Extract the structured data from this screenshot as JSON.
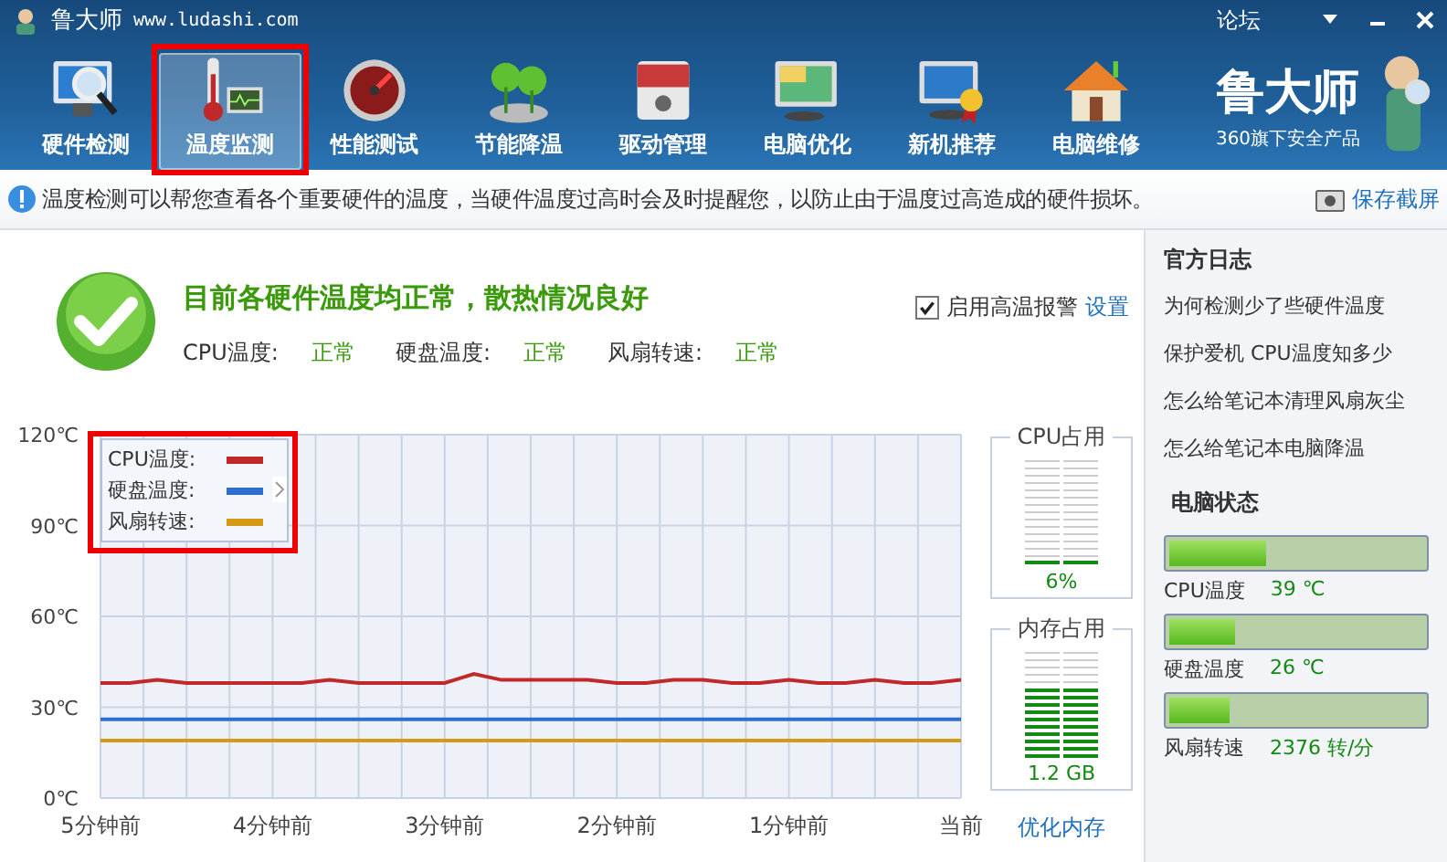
{
  "window": {
    "title": "鲁大师",
    "url": "www.ludashi.com",
    "forum_link": "论坛"
  },
  "toolbar": [
    {
      "label": "硬件检测",
      "selected": false,
      "highlighted": false
    },
    {
      "label": "温度监测",
      "selected": true,
      "highlighted": true
    },
    {
      "label": "性能测试",
      "selected": false,
      "highlighted": false
    },
    {
      "label": "节能降温",
      "selected": false,
      "highlighted": false
    },
    {
      "label": "驱动管理",
      "selected": false,
      "highlighted": false
    },
    {
      "label": "电脑优化",
      "selected": false,
      "highlighted": false
    },
    {
      "label": "新机推荐",
      "selected": false,
      "highlighted": false
    },
    {
      "label": "电脑维修",
      "selected": false,
      "highlighted": false
    }
  ],
  "brand": {
    "name": "鲁大师",
    "tagline": "360旗下安全产品"
  },
  "info_bar": {
    "text": "温度检测可以帮您查看各个重要硬件的温度，当硬件温度过高时会及时提醒您，以防止由于温度过高造成的硬件损坏。",
    "action": "保存截屏"
  },
  "status": {
    "headline": "目前各硬件温度均正常，散热情况良好",
    "items": [
      {
        "label": "CPU温度:",
        "value": "正常"
      },
      {
        "label": "硬盘温度:",
        "value": "正常"
      },
      {
        "label": "风扇转速:",
        "value": "正常"
      }
    ],
    "alarm": {
      "label": "启用高温报警",
      "checked": true
    },
    "settings_link": "设置"
  },
  "chart_data": {
    "type": "line",
    "x": [
      -5,
      -4.83,
      -4.67,
      -4.5,
      -4.33,
      -4.17,
      -4,
      -3.83,
      -3.67,
      -3.5,
      -3.33,
      -3.17,
      -3,
      -2.83,
      -2.67,
      -2.5,
      -2.33,
      -2.17,
      -2,
      -1.83,
      -1.67,
      -1.5,
      -1.33,
      -1.17,
      -1,
      -0.83,
      -0.67,
      -0.5,
      -0.33,
      -0.17,
      0
    ],
    "xlim": [
      -5,
      0
    ],
    "ylim": [
      0,
      120
    ],
    "grid": true,
    "legend": true,
    "yticks": [
      {
        "value": 0,
        "label": "0℃"
      },
      {
        "value": 30,
        "label": "30℃"
      },
      {
        "value": 60,
        "label": "60℃"
      },
      {
        "value": 90,
        "label": "90℃"
      },
      {
        "value": 120,
        "label": "120℃"
      }
    ],
    "xticks": [
      {
        "value": -5,
        "label": "5分钟前"
      },
      {
        "value": -4,
        "label": "4分钟前"
      },
      {
        "value": -3,
        "label": "3分钟前"
      },
      {
        "value": -2,
        "label": "2分钟前"
      },
      {
        "value": -1,
        "label": "1分钟前"
      },
      {
        "value": 0,
        "label": "当前"
      }
    ],
    "series": [
      {
        "name": "CPU温度:",
        "color": "#c0282a",
        "values": [
          38,
          38,
          39,
          38,
          38,
          38,
          38,
          38,
          39,
          38,
          38,
          38,
          38,
          41,
          39,
          39,
          39,
          39,
          38,
          38,
          39,
          39,
          38,
          38,
          39,
          38,
          38,
          39,
          38,
          38,
          39
        ]
      },
      {
        "name": "硬盘温度:",
        "color": "#2f6fcc",
        "values": [
          26,
          26,
          26,
          26,
          26,
          26,
          26,
          26,
          26,
          26,
          26,
          26,
          26,
          26,
          26,
          26,
          26,
          26,
          26,
          26,
          26,
          26,
          26,
          26,
          26,
          26,
          26,
          26,
          26,
          26,
          26
        ]
      },
      {
        "name": "风扇转速:",
        "color": "#d49a14",
        "values": [
          19,
          19,
          19,
          19,
          19,
          19,
          19,
          19,
          19,
          19,
          19,
          19,
          19,
          19,
          19,
          19,
          19,
          19,
          19,
          19,
          19,
          19,
          19,
          19,
          19,
          19,
          19,
          19,
          19,
          19,
          19
        ]
      }
    ]
  },
  "legend_highlighted": true,
  "meters": [
    {
      "title": "CPU占用",
      "level": 0.06,
      "reading": "6%"
    },
    {
      "title": "内存占用",
      "level": 0.65,
      "reading": "1.2 GB"
    }
  ],
  "optimize_link": "优化内存",
  "sidebar": {
    "title": "官方日志",
    "articles": [
      "为何检测少了些硬件温度",
      "保护爱机 CPU温度知多少",
      "怎么给笔记本清理风扇灰尘",
      "怎么给笔记本电脑降温"
    ],
    "status_title": "电脑状态",
    "gauges": [
      {
        "label": "CPU温度",
        "value": "39 ℃",
        "level": 0.38
      },
      {
        "label": "硬盘温度",
        "value": "26 ℃",
        "level": 0.26
      },
      {
        "label": "风扇转速",
        "value": "2376 转/分",
        "level": 0.24
      }
    ]
  }
}
